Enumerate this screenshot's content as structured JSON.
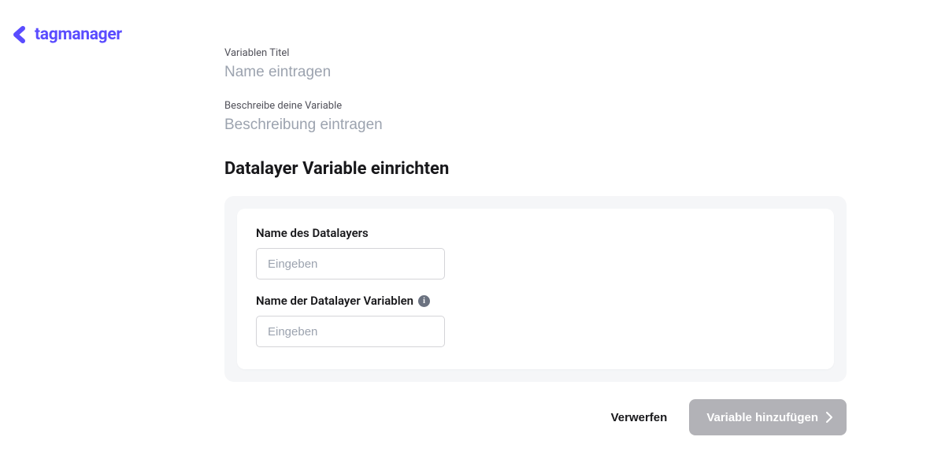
{
  "logo": {
    "text": "tagmanager"
  },
  "fields": {
    "title": {
      "label": "Variablen Titel",
      "placeholder": "Name eintragen"
    },
    "description": {
      "label": "Beschreibe deine Variable",
      "placeholder": "Beschreibung eintragen"
    }
  },
  "section": {
    "heading": "Datalayer Variable einrichten",
    "datalayerName": {
      "label": "Name des Datalayers",
      "placeholder": "Eingeben"
    },
    "variableName": {
      "label": "Name der Datalayer Variablen",
      "placeholder": "Eingeben"
    }
  },
  "actions": {
    "discard": "Verwerfen",
    "submit": "Variable hinzufügen"
  }
}
